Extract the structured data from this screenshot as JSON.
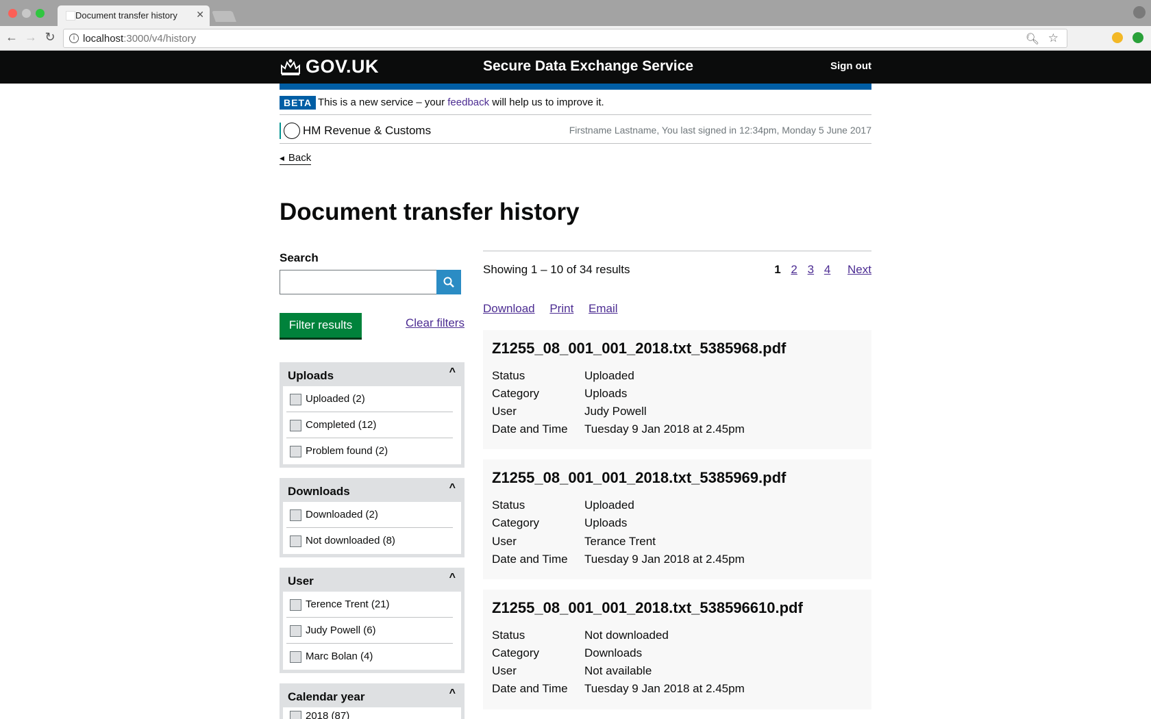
{
  "browser": {
    "tab_title": "Document transfer history",
    "url_host": "localhost",
    "url_path": ":3000/v4/history"
  },
  "header": {
    "logo": "GOV.UK",
    "service_name": "Secure Data Exchange Service",
    "sign_out": "Sign out"
  },
  "phase": {
    "tag": "BETA",
    "text_before": "This is a new service – your ",
    "link": "feedback",
    "text_after": " will help us to improve it."
  },
  "org": {
    "name": "HM Revenue & Customs",
    "last_signed": "Firstname Lastname, You last signed in 12:34pm, Monday 5 June 2017"
  },
  "back": "Back",
  "page_title": "Document transfer history",
  "sidebar": {
    "search_label": "Search",
    "search_value": "",
    "filter_button": "Filter results",
    "clear_filters": "Clear filters",
    "facets": [
      {
        "title": "Uploads",
        "chevron": "^",
        "options": [
          "Uploaded (2)",
          "Completed (12)",
          "Problem found (2)"
        ]
      },
      {
        "title": "Downloads",
        "chevron": "^",
        "options": [
          "Downloaded (2)",
          "Not downloaded (8)"
        ]
      },
      {
        "title": "User",
        "chevron": "^",
        "options": [
          "Terence Trent (21)",
          "Judy Powell (6)",
          "Marc Bolan (4)"
        ]
      },
      {
        "title": "Calendar year",
        "chevron": "^",
        "options": [
          "2018 (87)"
        ]
      }
    ]
  },
  "results": {
    "showing": "Showing 1 – 10 of 34 results",
    "pages": [
      "1",
      "2",
      "3",
      "4"
    ],
    "next": "Next",
    "actions": [
      "Download",
      "Print",
      "Email"
    ],
    "field_labels": {
      "status": "Status",
      "category": "Category",
      "user": "User",
      "datetime": "Date and Time"
    },
    "items": [
      {
        "title": "Z1255_08_001_001_2018.txt_5385968.pdf",
        "status": "Uploaded",
        "category": "Uploads",
        "user": "Judy Powell",
        "datetime": "Tuesday 9 Jan 2018 at 2.45pm"
      },
      {
        "title": "Z1255_08_001_001_2018.txt_5385969.pdf",
        "status": "Uploaded",
        "category": "Uploads",
        "user": "Terance Trent",
        "datetime": "Tuesday 9 Jan 2018 at 2.45pm"
      },
      {
        "title": "Z1255_08_001_001_2018.txt_538596610.pdf",
        "status": "Not downloaded",
        "category": "Downloads",
        "user": "Not available",
        "datetime": "Tuesday 9 Jan 2018 at 2.45pm"
      }
    ]
  },
  "colors": {
    "header_bg": "#0b0c0c",
    "brand_blue": "#005ea5",
    "button_green": "#00823b",
    "link_purple": "#4c2c92",
    "search_blue": "#2b8cc4"
  }
}
